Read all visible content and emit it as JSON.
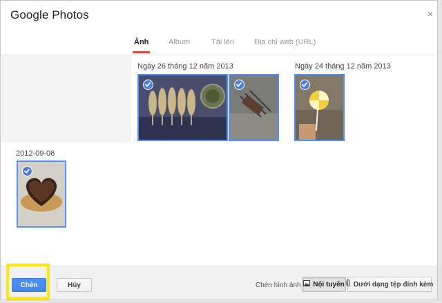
{
  "dialog": {
    "title": "Google Photos",
    "close_glyph": "×"
  },
  "tabs": [
    {
      "label": "Ảnh",
      "active": true
    },
    {
      "label": "Album",
      "active": false
    },
    {
      "label": "Tải lên",
      "active": false
    },
    {
      "label": "Địa chỉ web (URL)",
      "active": false
    }
  ],
  "groups": [
    {
      "date": "Ngày 26 tháng 12 năm 2013",
      "photos": [
        {
          "subject": "grilled corn",
          "selected": true
        },
        {
          "subject": "grill on street",
          "selected": true
        }
      ]
    },
    {
      "date": "Ngày 24 tháng 12 năm 2013",
      "photos": [
        {
          "subject": "lollipop",
          "selected": true
        }
      ]
    },
    {
      "date": "2012-09-06",
      "photos": [
        {
          "subject": "heart cake",
          "selected": true
        }
      ]
    }
  ],
  "footer": {
    "insert_button": "Chèn",
    "cancel_button": "Hủy",
    "insert_image_label": "Chèn hình ảnh",
    "inline_button": "Nội tuyến",
    "attachment_button": "Dưới dạng tệp đính kèm"
  },
  "colors": {
    "accent": "#4d90fe",
    "active_tab_underline": "#dd4b39",
    "highlight": "#ffea00"
  }
}
